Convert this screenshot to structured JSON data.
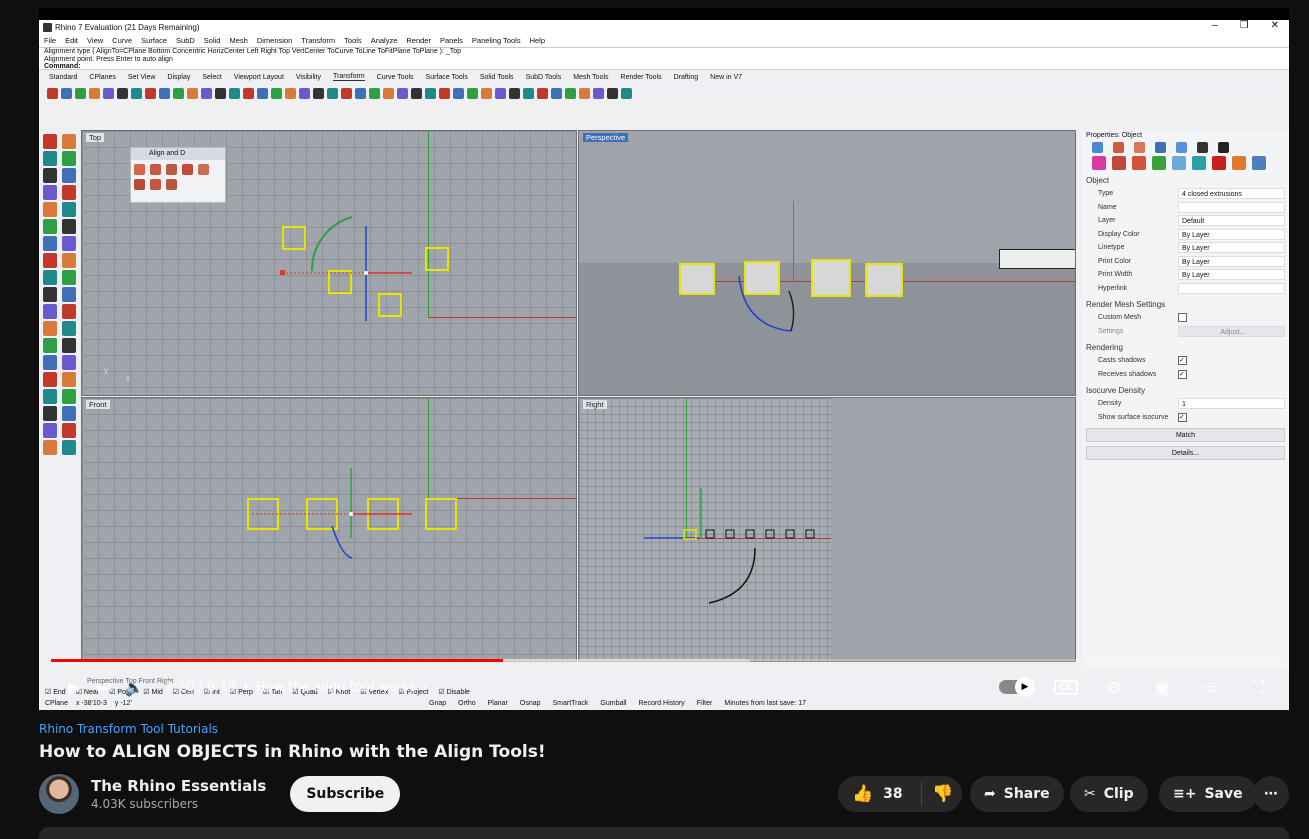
{
  "rhino": {
    "window_title": "Rhino 7 Evaluation (21 Days Remaining)",
    "menu": [
      "File",
      "Edit",
      "View",
      "Curve",
      "Surface",
      "SubD",
      "Solid",
      "Mesh",
      "Dimension",
      "Transform",
      "Tools",
      "Analyze",
      "Render",
      "Panels",
      "Paneling Tools",
      "Help"
    ],
    "cmd_line1": "Alignment type ( AlignTo=CPlane  Bottom  Concentric  HorizCenter  Left  Right  Top  VertCenter  ToCurve  ToLine  ToFitPlane  ToPlane ): _Top",
    "cmd_line2": "Alignment point. Press Enter to auto align",
    "cmd_prompt": "Command:",
    "tabs": [
      "Standard",
      "CPlanes",
      "Set View",
      "Display",
      "Select",
      "Viewport Layout",
      "Visibility",
      "Transform",
      "Curve Tools",
      "Surface Tools",
      "Solid Tools",
      "SubD Tools",
      "Mesh Tools",
      "Render Tools",
      "Drafting",
      "New in V7"
    ],
    "active_tab": "Transform",
    "viewports": {
      "top": "Top",
      "perspective": "Perspective",
      "front": "Front",
      "right": "Right"
    },
    "align_panel_title": "Align and D",
    "props": {
      "header": "Properties: Object",
      "section_object": "Object",
      "rows": [
        {
          "k": "Type",
          "v": "4 closed extrusions"
        },
        {
          "k": "Name",
          "v": ""
        },
        {
          "k": "Layer",
          "v": "Default"
        },
        {
          "k": "Display Color",
          "v": "By Layer"
        },
        {
          "k": "Linetype",
          "v": "By Layer"
        },
        {
          "k": "Print Color",
          "v": "By Layer"
        },
        {
          "k": "Print Width",
          "v": "By Layer"
        },
        {
          "k": "Hyperlink",
          "v": ""
        }
      ],
      "section_mesh": "Render Mesh Settings",
      "custom_mesh": "Custom Mesh",
      "settings": "Settings",
      "adjust": "Adjust...",
      "section_rendering": "Rendering",
      "casts": "Casts shadows",
      "receives": "Receives shadows",
      "section_iso": "Isocurve Density",
      "density_label": "Density",
      "density_value": "1",
      "show_iso": "Show surface isocurve",
      "match": "Match",
      "details": "Details..."
    },
    "status": {
      "vp_tabs": "Perspective  Top  Front  Right",
      "osnaps": [
        "End",
        "Near",
        "Point",
        "Mid",
        "Cen",
        "Int",
        "Perp",
        "Tan",
        "Quad",
        "Knot",
        "Vertex",
        "Project",
        "Disable"
      ],
      "cplane": "CPlane",
      "coords": "x -38'10-3",
      "coords_y": "y -12'",
      "bottom_items": [
        "Gnap",
        "Ortho",
        "Planar",
        "Osnap",
        "SmartTrack",
        "Gumball",
        "Record History",
        "Filter",
        "Minutes from last save: 17"
      ]
    }
  },
  "player": {
    "time": "2:20 / 6:19",
    "chapter": "How the align tool works",
    "progress_fraction": 0.369,
    "buffer_fraction": 0.57,
    "cc_label": "CC"
  },
  "video": {
    "playlist": "Rhino Transform Tool Tutorials",
    "title": "How to ALIGN OBJECTS in Rhino with the Align Tools!",
    "channel": "The Rhino Essentials",
    "subscribers": "4.03K subscribers",
    "subscribe": "Subscribe",
    "likes": "38",
    "share": "Share",
    "clip": "Clip",
    "save": "Save"
  },
  "colors": {
    "accent_red": "#ff0000",
    "link_blue": "#3ea6ff",
    "selection_yellow": "#e8e400"
  }
}
